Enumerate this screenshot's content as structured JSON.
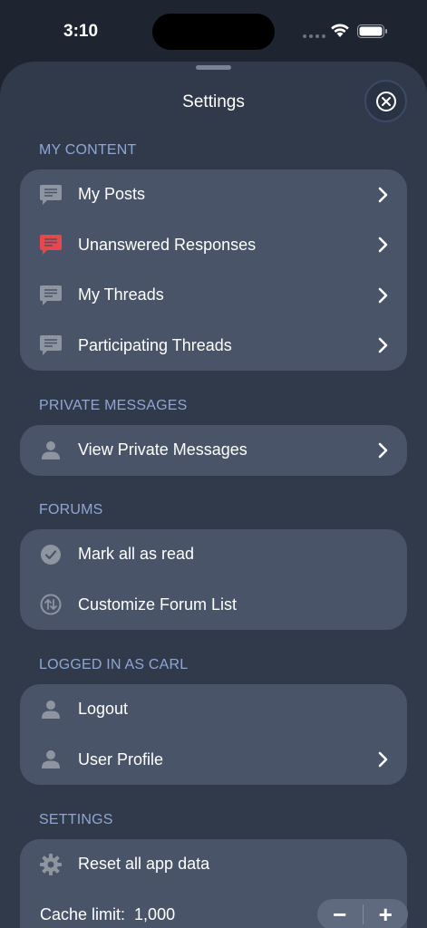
{
  "status_bar": {
    "time": "3:10"
  },
  "sheet": {
    "title": "Settings"
  },
  "sections": {
    "my_content": {
      "header": "MY CONTENT",
      "items": [
        {
          "label": "My Posts",
          "icon": "chat-bubble-icon"
        },
        {
          "label": "Unanswered Responses",
          "icon": "chat-bubble-red-icon",
          "icon_color": "#e5484d"
        },
        {
          "label": "My Threads",
          "icon": "chat-bubble-icon"
        },
        {
          "label": "Participating Threads",
          "icon": "chat-bubble-icon"
        }
      ]
    },
    "private_messages": {
      "header": "PRIVATE MESSAGES",
      "items": [
        {
          "label": "View Private Messages",
          "icon": "person-icon"
        }
      ]
    },
    "forums": {
      "header": "FORUMS",
      "items": [
        {
          "label": "Mark all as read",
          "icon": "checkmark-circle-icon"
        },
        {
          "label": "Customize Forum List",
          "icon": "reorder-arrows-icon"
        }
      ]
    },
    "logged_in": {
      "header": "LOGGED IN AS CARL",
      "items": [
        {
          "label": "Logout",
          "icon": "person-icon"
        },
        {
          "label": "User Profile",
          "icon": "person-icon"
        }
      ]
    },
    "settings": {
      "header": "SETTINGS",
      "reset_label": "Reset all app data",
      "cache_label": "Cache limit:",
      "cache_value": "1,000",
      "stepper_minus": "−",
      "stepper_plus": "+"
    }
  },
  "colors": {
    "background": "#1e2430",
    "sheet": "#313a4b",
    "group": "#4a5468",
    "section_header": "#8fa6d4",
    "icon_gray": "#8e95a1",
    "icon_red": "#e5484d"
  }
}
